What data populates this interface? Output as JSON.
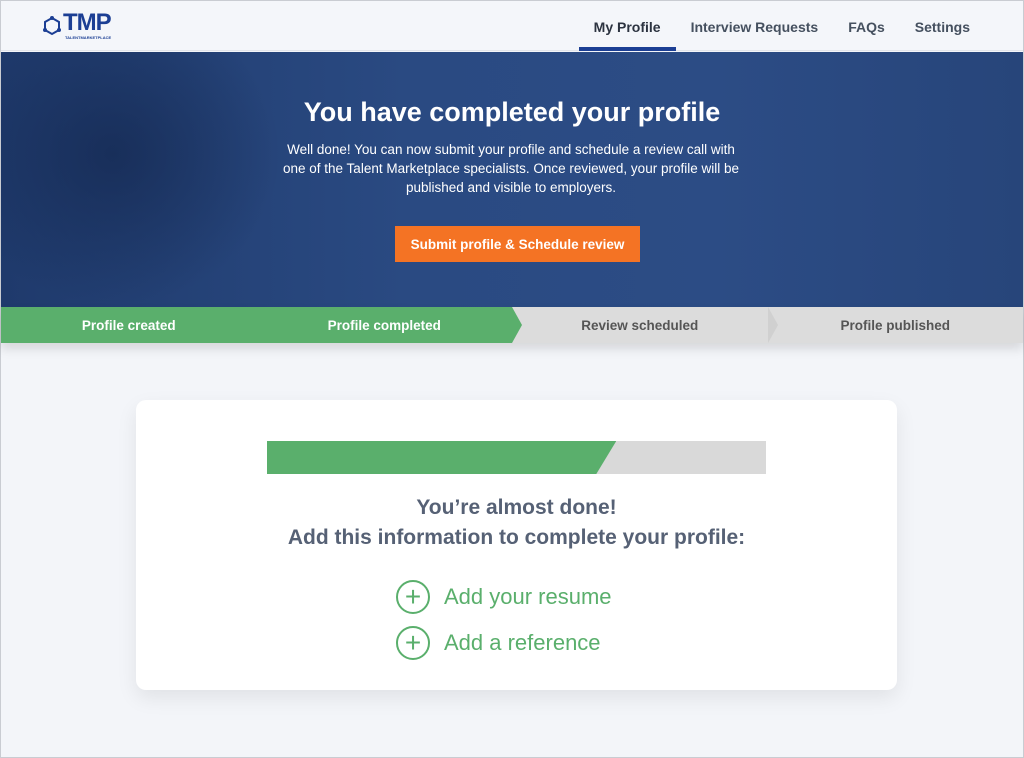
{
  "brand": {
    "name": "TMP",
    "tagline": "TALENTMARKETPLACE"
  },
  "nav": [
    {
      "label": "My Profile",
      "active": true
    },
    {
      "label": "Interview Requests"
    },
    {
      "label": "FAQs"
    },
    {
      "label": "Settings"
    }
  ],
  "hero": {
    "title": "You have completed your profile",
    "text": "Well done! You can now submit your profile and schedule a review call with one of the Talent Marketplace specialists. Once reviewed, your profile will be published and visible to employers.",
    "button": "Submit profile & Schedule review"
  },
  "steps": [
    {
      "label": "Profile created",
      "status": "done"
    },
    {
      "label": "Profile completed",
      "status": "done"
    },
    {
      "label": "Review scheduled",
      "status": "todo"
    },
    {
      "label": "Profile published",
      "status": "todo"
    }
  ],
  "card": {
    "progress_percent": 70,
    "line1": "You’re almost done!",
    "line2": "Add this information to complete your profile:",
    "actions": [
      {
        "label": "Add your resume",
        "icon": "plus-circle-icon"
      },
      {
        "label": "Add a reference",
        "icon": "plus-circle-icon"
      }
    ]
  },
  "colors": {
    "brand": "#1c3f94",
    "accent": "#f47324",
    "success": "#5aaf6c"
  }
}
